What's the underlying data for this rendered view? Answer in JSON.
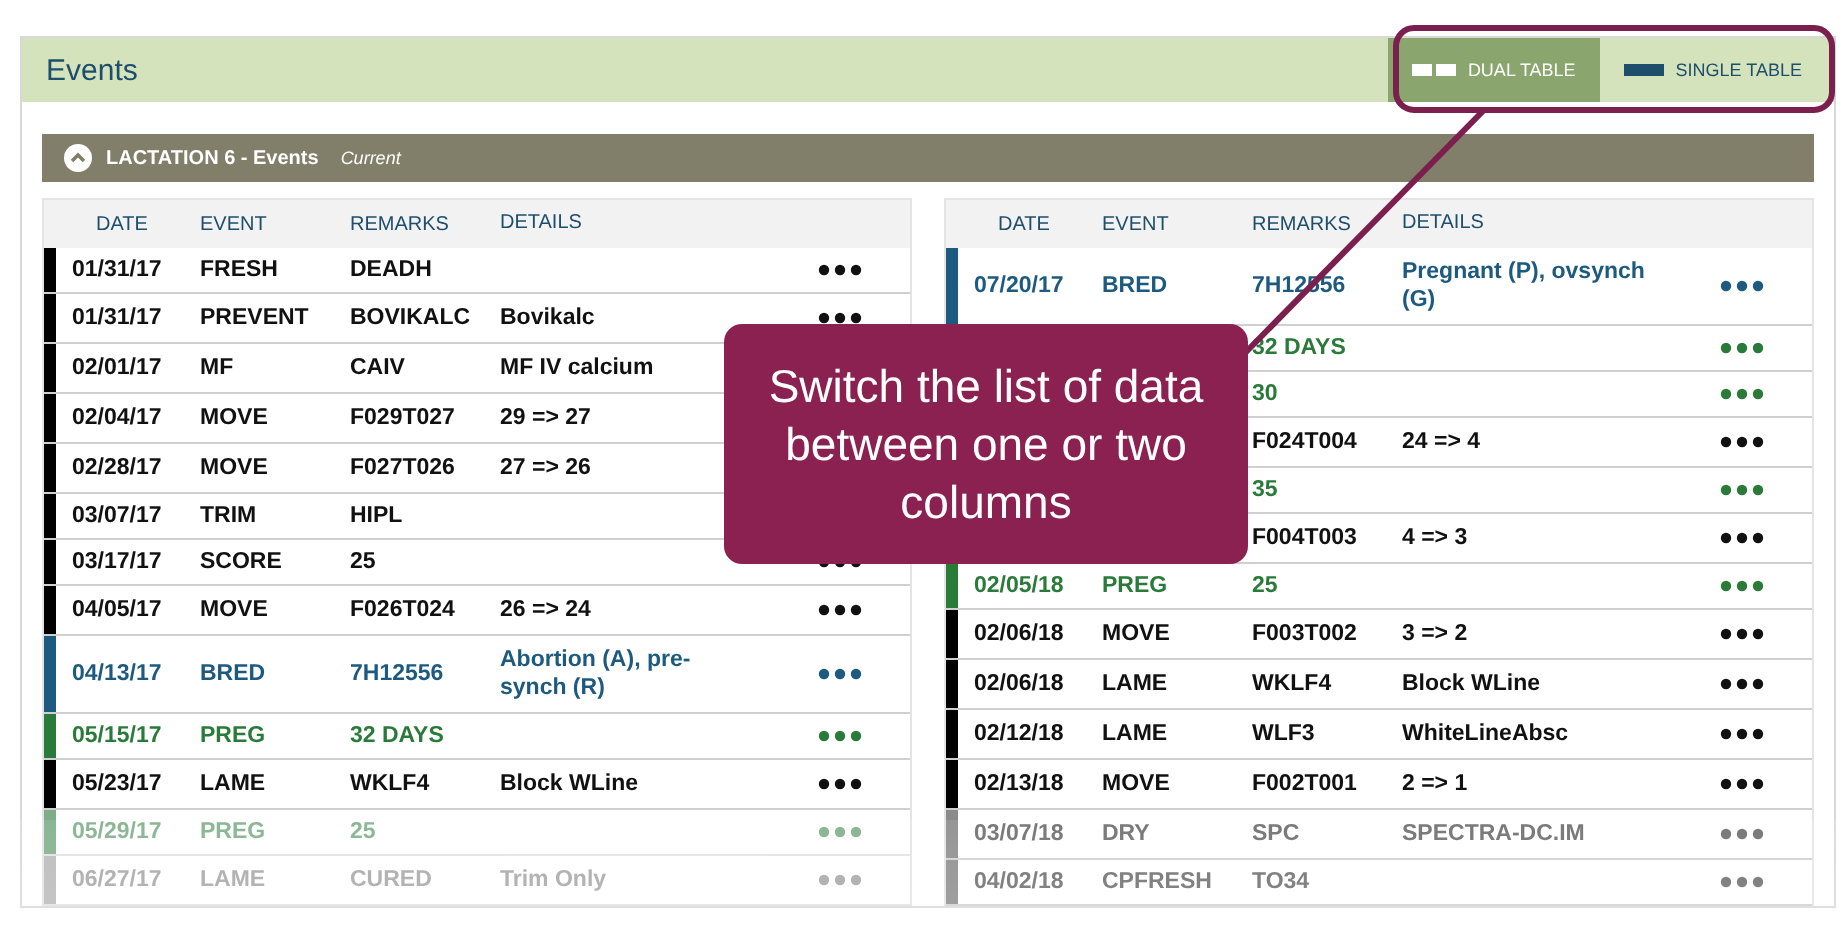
{
  "header": {
    "title": "Events"
  },
  "view_toggle": [
    {
      "label": "DUAL TABLE",
      "kind": "dual",
      "selected": true
    },
    {
      "label": "SINGLE TABLE",
      "kind": "single",
      "selected": false
    }
  ],
  "lactation": {
    "title": "LACTATION 6 - Events",
    "status": "Current",
    "expanded": true
  },
  "tables": [
    {
      "columns": [
        "DATE",
        "EVENT",
        "REMARKS",
        "DETAILS"
      ],
      "rows": [
        {
          "date": "01/31/17",
          "event": "FRESH",
          "remarks": "DEADH",
          "kind": "normal",
          "faded": false
        },
        {
          "date": "01/31/17",
          "event": "PREVENT",
          "remarks": "BOVIKALC",
          "details": "Bovikalc",
          "kind": "normal",
          "faded": false
        },
        {
          "date": "02/01/17",
          "event": "MF",
          "remarks": "CAIV",
          "details": "MF IV calcium",
          "kind": "normal",
          "faded": false
        },
        {
          "date": "02/04/17",
          "event": "MOVE",
          "remarks": "F029T027",
          "details": "29 => 27",
          "kind": "normal",
          "faded": false
        },
        {
          "date": "02/28/17",
          "event": "MOVE",
          "remarks": "F027T026",
          "details": "27 => 26",
          "kind": "normal",
          "faded": false
        },
        {
          "date": "03/07/17",
          "event": "TRIM",
          "remarks": "HIPL",
          "kind": "normal",
          "faded": false
        },
        {
          "date": "03/17/17",
          "event": "SCORE",
          "remarks": "25",
          "kind": "normal",
          "faded": false
        },
        {
          "date": "04/05/17",
          "event": "MOVE",
          "remarks": "F026T024",
          "details": "26 => 24",
          "kind": "normal",
          "faded": false
        },
        {
          "date": "04/13/17",
          "event": "BRED",
          "remarks": "7H12556",
          "details": "Abortion (A), pre-synch (R)",
          "kind": "bred",
          "faded": false
        },
        {
          "date": "05/15/17",
          "event": "PREG",
          "remarks": "32 DAYS",
          "kind": "preg",
          "faded": false
        },
        {
          "date": "05/23/17",
          "event": "LAME",
          "remarks": "WKLF4",
          "details": "Block WLine",
          "kind": "normal",
          "faded": false
        },
        {
          "date": "05/29/17",
          "event": "PREG",
          "remarks": "25",
          "kind": "preg",
          "faded": true
        },
        {
          "date": "06/27/17",
          "event": "LAME",
          "remarks": "CURED",
          "details": "Trim Only",
          "kind": "dry",
          "faded": true
        }
      ]
    },
    {
      "columns": [
        "DATE",
        "EVENT",
        "REMARKS",
        "DETAILS"
      ],
      "rows": [
        {
          "date": "07/20/17",
          "event": "BRED",
          "remarks": "7H12556",
          "details": "Pregnant (P), ovsynch (G)",
          "kind": "bred",
          "faded": false
        },
        {
          "remarks": "32 DAYS",
          "kind": "preg",
          "faded": false
        },
        {
          "remarks": "30",
          "kind": "preg",
          "faded": false
        },
        {
          "remarks": "F024T004",
          "details": "24 => 4",
          "kind": "normal",
          "faded": false
        },
        {
          "remarks": "35",
          "kind": "preg",
          "faded": false
        },
        {
          "remarks": "F004T003",
          "details": "4 => 3",
          "kind": "normal",
          "faded": false
        },
        {
          "date": "02/05/18",
          "event": "PREG",
          "remarks": "25",
          "kind": "preg",
          "faded": false
        },
        {
          "date": "02/06/18",
          "event": "MOVE",
          "remarks": "F003T002",
          "details": "3 => 2",
          "kind": "normal",
          "faded": false
        },
        {
          "date": "02/06/18",
          "event": "LAME",
          "remarks": "WKLF4",
          "details": "Block WLine",
          "kind": "normal",
          "faded": false
        },
        {
          "date": "02/12/18",
          "event": "LAME",
          "remarks": "WLF3",
          "details": "WhiteLineAbsc",
          "kind": "normal",
          "faded": false
        },
        {
          "date": "02/13/18",
          "event": "MOVE",
          "remarks": "F002T001",
          "details": "2 => 1",
          "kind": "normal",
          "faded": false
        },
        {
          "date": "03/07/18",
          "event": "DRY",
          "remarks": "SPC",
          "details": "SPECTRA-DC.IM",
          "kind": "dry",
          "faded": false
        },
        {
          "date": "04/02/18",
          "event": "CPFRESH",
          "remarks": "TO34",
          "kind": "dry",
          "faded": false
        }
      ]
    }
  ],
  "callout": {
    "text": "Switch the list of data between one or two columns"
  }
}
